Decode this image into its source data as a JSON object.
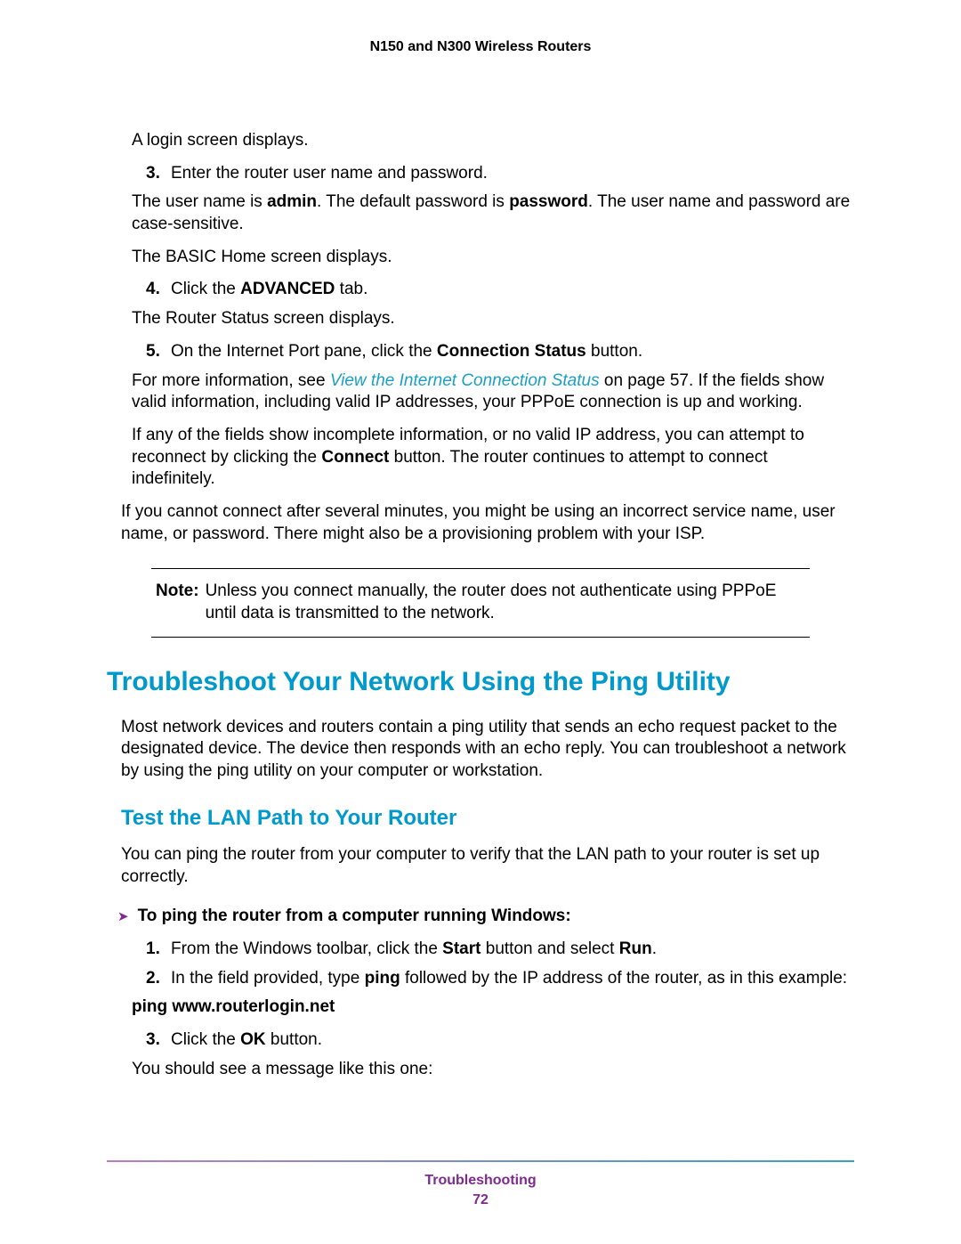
{
  "header": "N150 and N300 Wireless Routers",
  "body": {
    "pre_login": "A login screen displays.",
    "step3": {
      "num": "3.",
      "text": "Enter the router user name and password.",
      "sub1_pre": "The user name is ",
      "sub1_b1": "admin",
      "sub1_mid": ". The default password is ",
      "sub1_b2": "password",
      "sub1_post": ". The user name and password are case-sensitive.",
      "sub2": "The BASIC Home screen displays."
    },
    "step4": {
      "num": "4.",
      "pre": "Click the ",
      "b": "ADVANCED",
      "post": " tab.",
      "sub": "The Router Status screen displays."
    },
    "step5": {
      "num": "5.",
      "pre": "On the Internet Port pane, click the ",
      "b": "Connection Status",
      "post": " button.",
      "sub1_pre": "For more information, see ",
      "sub1_link": "View the Internet Connection Status",
      "sub1_post": " on page 57. If the fields show valid information, including valid IP addresses, your PPPoE connection is up and working.",
      "sub2_pre": "If any of the fields show incomplete information, or no valid IP address, you can attempt to reconnect by clicking the ",
      "sub2_b": "Connect",
      "sub2_post": " button. The router continues to attempt to connect indefinitely."
    },
    "outro": "If you cannot connect after several minutes, you might be using an incorrect service name, user name, or password. There might also be a provisioning problem with your ISP.",
    "note_label": "Note:",
    "note_text": "Unless you connect manually, the router does not authenticate using PPPoE until data is transmitted to the network."
  },
  "section2": {
    "heading": "Troubleshoot Your Network Using the Ping Utility",
    "intro": "Most network devices and routers contain a ping utility that sends an echo request packet to the designated device. The device then responds with an echo reply. You can troubleshoot a network by using the ping utility on your computer or workstation.",
    "subheading": "Test the LAN Path to Your Router",
    "subintro": "You can ping the router from your computer to verify that the LAN path to your router is set up correctly.",
    "proc_title": "To ping the router from a computer running Windows:",
    "pstep1": {
      "num": "1.",
      "pre": "From the Windows toolbar, click the ",
      "b1": "Start",
      "mid": " button and select ",
      "b2": "Run",
      "post": "."
    },
    "pstep2": {
      "num": "2.",
      "pre": "In the field provided, type ",
      "b": "ping",
      "post": " followed by the IP address of the router, as in this example:",
      "example": "ping www.routerlogin.net"
    },
    "pstep3": {
      "num": "3.",
      "pre": "Click the ",
      "b": "OK",
      "post": " button.",
      "sub": "You should see a message like this one:"
    }
  },
  "footer": {
    "label": "Troubleshooting",
    "page": "72"
  }
}
